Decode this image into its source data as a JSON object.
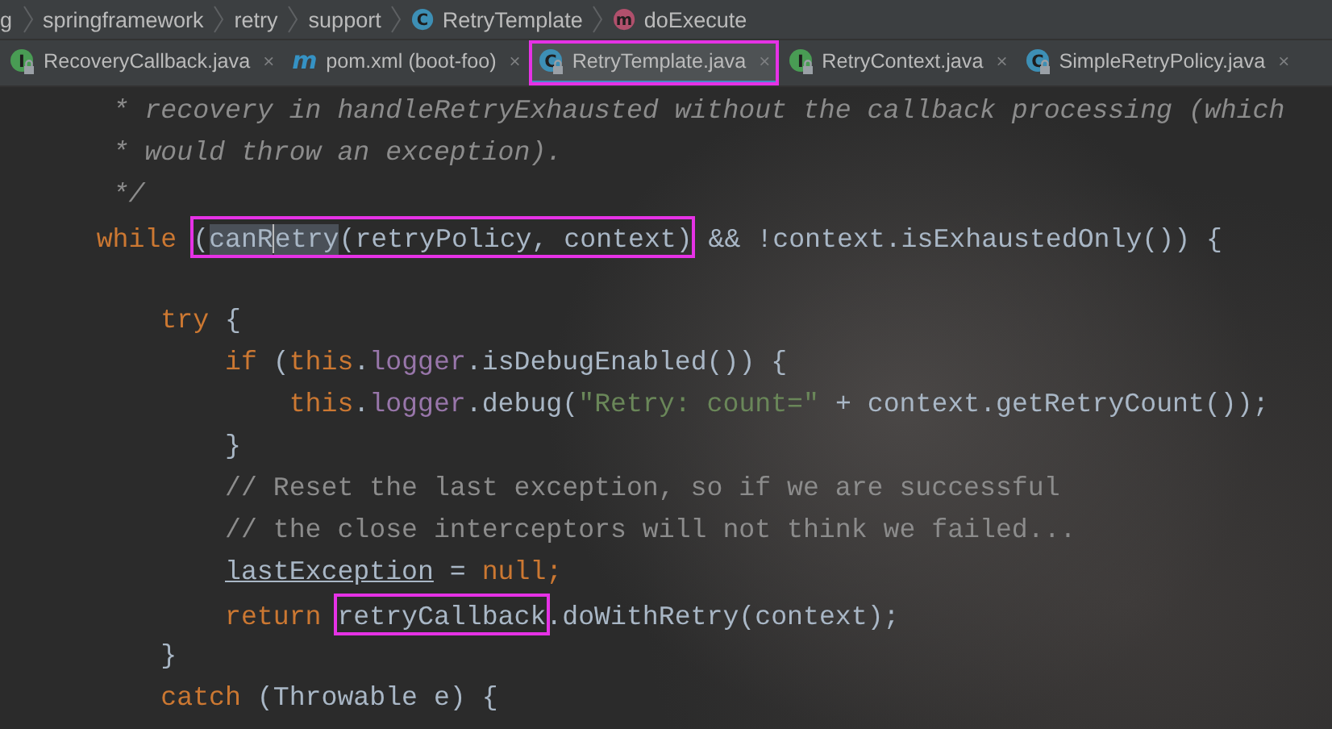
{
  "breadcrumbs": [
    {
      "label": "g"
    },
    {
      "label": "springframework"
    },
    {
      "label": "retry"
    },
    {
      "label": "support"
    },
    {
      "label": "RetryTemplate",
      "icon": {
        "kind": "class",
        "letter": "C"
      }
    },
    {
      "label": "doExecute",
      "icon": {
        "kind": "method",
        "letter": "m"
      }
    }
  ],
  "tabs": [
    {
      "label": "RecoveryCallback.java",
      "icon": {
        "kind": "interface",
        "letter": "I"
      },
      "locked": true,
      "selected": false,
      "highlighted": false,
      "close": "×"
    },
    {
      "label": "pom.xml (boot-foo)",
      "icon": {
        "kind": "maven",
        "letter": "m"
      },
      "locked": false,
      "selected": false,
      "highlighted": false,
      "close": "×"
    },
    {
      "label": "RetryTemplate.java",
      "icon": {
        "kind": "class",
        "letter": "C"
      },
      "locked": true,
      "selected": true,
      "highlighted": true,
      "close": "×"
    },
    {
      "label": "RetryContext.java",
      "icon": {
        "kind": "interface",
        "letter": "I"
      },
      "locked": true,
      "selected": false,
      "highlighted": false,
      "close": "×"
    },
    {
      "label": "SimpleRetryPolicy.java",
      "icon": {
        "kind": "class",
        "letter": "C"
      },
      "locked": true,
      "selected": false,
      "highlighted": false,
      "close": "×"
    }
  ],
  "code_lines": [
    {
      "blank_line_before": false,
      "tokens": [
        {
          "t": "     * recovery in handleRetryExhausted without the callback processing (which",
          "kind": "doc"
        }
      ]
    },
    {
      "blank_line_before": false,
      "tokens": [
        {
          "t": "     * would throw an exception).",
          "kind": "doc"
        }
      ]
    },
    {
      "blank_line_before": false,
      "tokens": [
        {
          "t": "     */",
          "kind": "doc"
        }
      ]
    },
    {
      "blank_line_before": false,
      "tokens": [
        {
          "t": "    while ",
          "kind": "keyword"
        },
        {
          "t": "(",
          "kind": "plain",
          "boxed": true,
          "selected": false
        },
        {
          "t": "canR",
          "kind": "plain",
          "boxed": true,
          "selected": true,
          "caret_after": true
        },
        {
          "t": "etry",
          "kind": "plain",
          "boxed": true,
          "selected": true,
          "caret_after": false
        },
        {
          "t": "(retryPolicy, context)",
          "kind": "plain",
          "boxed": true,
          "selected": false
        },
        {
          "t": " && !context.isExhaustedOnly()) {",
          "kind": "plain",
          "boxed": false
        }
      ]
    },
    {
      "blank_line_before": true,
      "tokens": [
        {
          "t": "        try",
          "kind": "keyword"
        },
        {
          "t": " {",
          "kind": "plain"
        }
      ]
    },
    {
      "blank_line_before": false,
      "tokens": [
        {
          "t": "            if",
          "kind": "keyword"
        },
        {
          "t": " (",
          "kind": "plain"
        },
        {
          "t": "this",
          "kind": "keyword"
        },
        {
          "t": ".",
          "kind": "plain"
        },
        {
          "t": "logger",
          "kind": "field"
        },
        {
          "t": ".isDebugEnabled()) {",
          "kind": "plain"
        }
      ]
    },
    {
      "blank_line_before": false,
      "tokens": [
        {
          "t": "                this",
          "kind": "keyword"
        },
        {
          "t": ".",
          "kind": "plain"
        },
        {
          "t": "logger",
          "kind": "field"
        },
        {
          "t": ".debug(",
          "kind": "plain"
        },
        {
          "t": "\"Retry: count=\"",
          "kind": "string"
        },
        {
          "t": " + context.getRetryCount());",
          "kind": "plain"
        }
      ]
    },
    {
      "blank_line_before": false,
      "tokens": [
        {
          "t": "            }",
          "kind": "plain"
        }
      ]
    },
    {
      "blank_line_before": false,
      "tokens": [
        {
          "t": "            // Reset the last exception, so if we are successful",
          "kind": "comment"
        }
      ]
    },
    {
      "blank_line_before": false,
      "tokens": [
        {
          "t": "            // the close interceptors will not think we failed...",
          "kind": "comment"
        }
      ]
    },
    {
      "blank_line_before": false,
      "tokens": [
        {
          "t": "            lastException",
          "kind": "underlined"
        },
        {
          "t": " = ",
          "kind": "plain"
        },
        {
          "t": "null;",
          "kind": "keyword"
        }
      ]
    },
    {
      "blank_line_before": false,
      "tokens": [
        {
          "t": "            return ",
          "kind": "keyword"
        },
        {
          "t": "retryCallback",
          "kind": "plain",
          "boxed": true
        },
        {
          "t": ".doWithRetry(context);",
          "kind": "plain",
          "boxed": false
        }
      ]
    },
    {
      "blank_line_before": false,
      "tokens": [
        {
          "t": "        }",
          "kind": "plain"
        }
      ]
    },
    {
      "blank_line_before": false,
      "tokens": [
        {
          "t": "        catch",
          "kind": "keyword"
        },
        {
          "t": " (Throwable e) {",
          "kind": "plain"
        }
      ]
    }
  ]
}
